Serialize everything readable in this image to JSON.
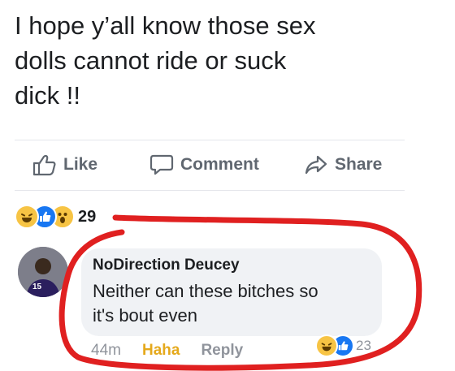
{
  "post": {
    "text": "I hope y’all know those sex\ndolls cannot ride or suck\ndick  !!"
  },
  "actions": {
    "like": "Like",
    "comment": "Comment",
    "share": "Share"
  },
  "reactions": {
    "icons": [
      "haha-icon",
      "like-icon",
      "wow-icon"
    ],
    "count": "29"
  },
  "comment": {
    "avatar_badge": "15",
    "author": "NoDirection Deucey",
    "text": "Neither can these bitches so\nit's bout even",
    "time": "44m",
    "haha_label": "Haha",
    "reply_label": "Reply",
    "reaction_icons": [
      "haha-icon",
      "like-icon"
    ],
    "reaction_count": "23"
  },
  "colors": {
    "facebook_blue": "#1877f2",
    "haha_yellow": "#f7c444",
    "annotation_red": "#e02020"
  }
}
